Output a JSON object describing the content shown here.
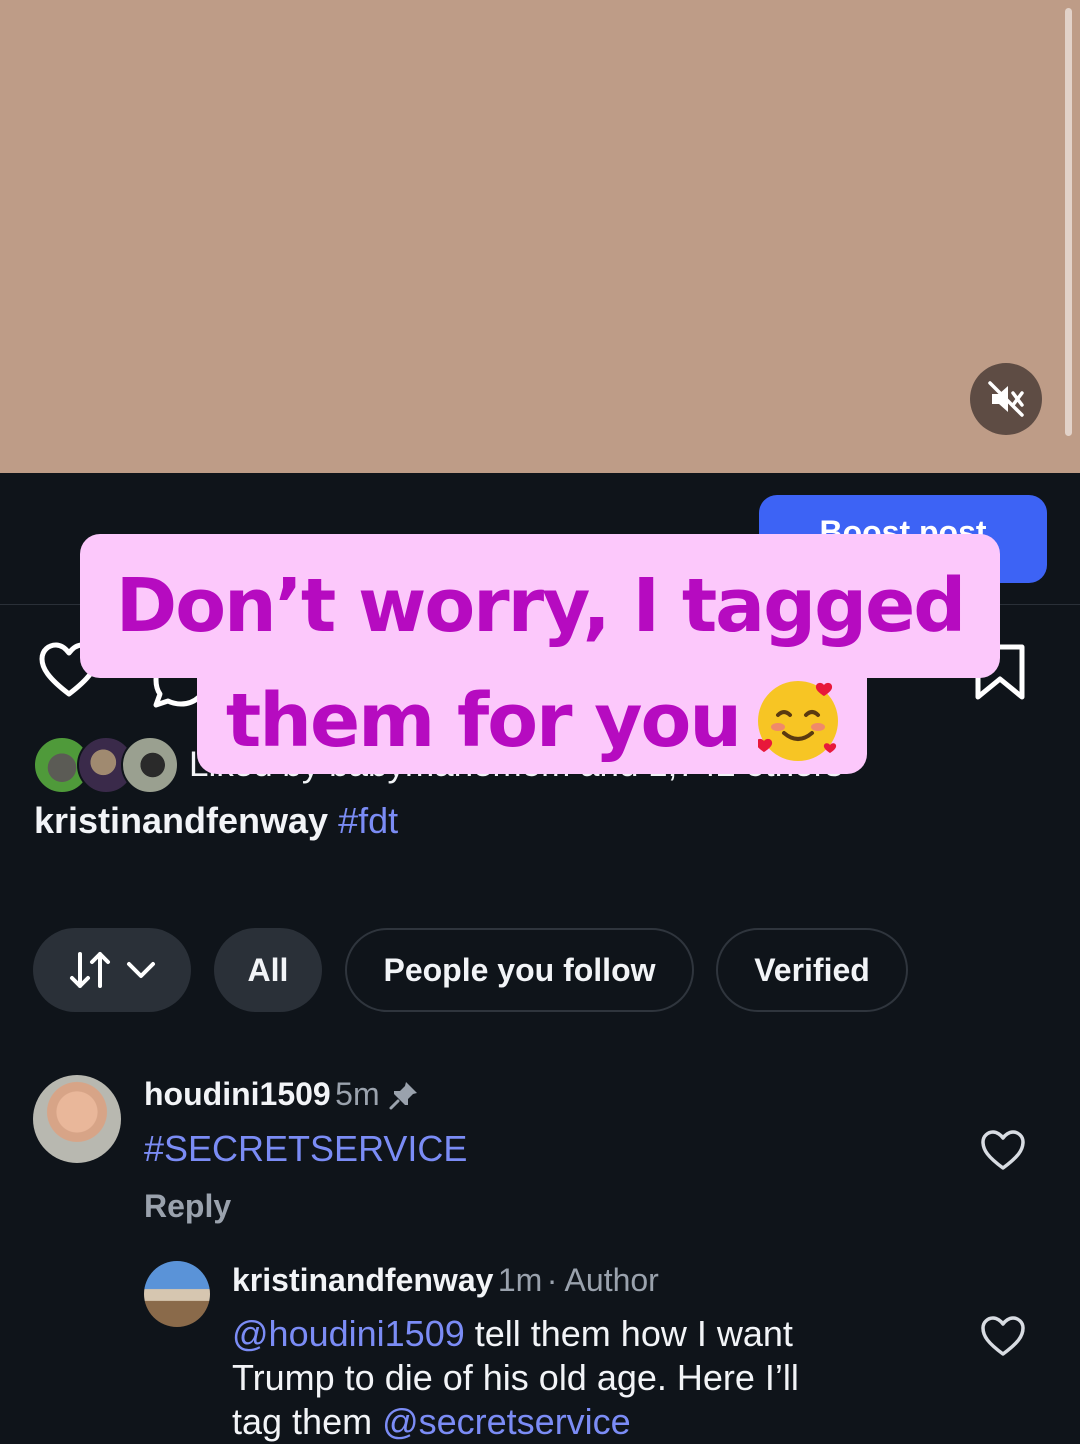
{
  "post": {
    "boost_label": "Boost post",
    "liked_by_text": "Liked by babymanemom and 1,742 others",
    "caption_user": "kristinandfenway",
    "caption_tag": "#fdt"
  },
  "overlay": {
    "line1": "Don’t worry, I tagged",
    "line2": "them for you"
  },
  "filters": {
    "all": "All",
    "people_you_follow": "People you follow",
    "verified": "Verified"
  },
  "comments": [
    {
      "user": "houdini1509",
      "time": "5m",
      "text": "#SECRETSERVICE",
      "reply_label": "Reply"
    },
    {
      "user": "kristinandfenway",
      "time": "1m",
      "author_label": "· Author",
      "mention1": "@houdini1509",
      "text_part1": " tell them how I want",
      "text_part2": "Trump to die of his old age. Here I’ll",
      "text_part3": "tag them ",
      "mention2": "@secretservice"
    }
  ],
  "colors": {
    "video_bg": "#be9c87",
    "app_bg": "#0f141a",
    "boost": "#3d63f5",
    "overlay_bg": "#fcc8fb",
    "overlay_text": "#b60bc0",
    "link": "#7b8cf5"
  }
}
